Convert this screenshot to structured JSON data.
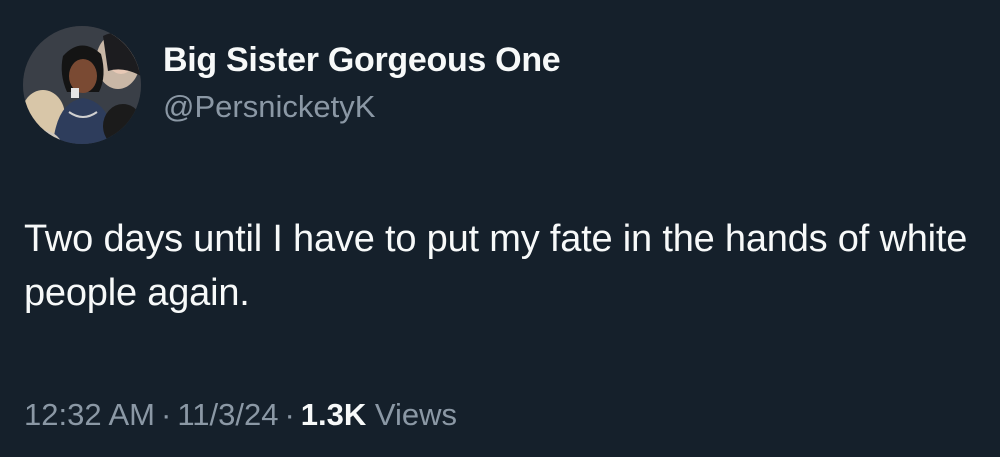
{
  "user": {
    "display_name": "Big Sister Gorgeous One",
    "handle": "@PersnicketyK",
    "avatar_icon": "profile-photo"
  },
  "tweet": {
    "text": "Two days until I have to put my fate in the hands of white people again."
  },
  "meta": {
    "time": "12:32 AM",
    "separator": "·",
    "date": "11/3/24",
    "views_count": "1.3K",
    "views_label": "Views"
  },
  "colors": {
    "background": "#15202b",
    "primary_text": "#f7f9f9",
    "secondary_text": "#8b98a5"
  }
}
